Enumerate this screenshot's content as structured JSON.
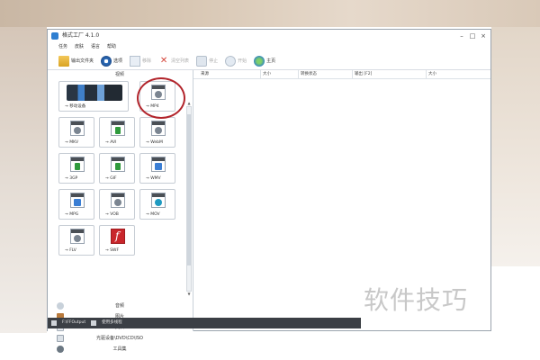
{
  "window": {
    "title": "格式工厂 4.1.0",
    "controls": [
      "–",
      "□",
      "×"
    ]
  },
  "menubar": [
    "任务",
    "皮肤",
    "语言",
    "帮助"
  ],
  "toolbar": {
    "output_folder": "输出文件夹",
    "options": "选项",
    "remove": "移除",
    "clear_list": "清空列表",
    "stop": "停止",
    "start": "开始",
    "home": "主页"
  },
  "left_panel": {
    "header": "视频",
    "tiles": [
      {
        "label": "→ 移动设备",
        "icon": "mobile-devices-icon"
      },
      {
        "label": "→ MP4",
        "icon": "mp4-file-icon"
      },
      {
        "label": "→ MKV",
        "icon": "mkv-file-icon"
      },
      {
        "label": "→ AVI",
        "icon": "avi-file-icon"
      },
      {
        "label": "→ WebM",
        "icon": "webm-file-icon"
      },
      {
        "label": "→ 3GP",
        "icon": "3gp-file-icon"
      },
      {
        "label": "→ GIF",
        "icon": "gif-file-icon"
      },
      {
        "label": "→ WMV",
        "icon": "wmv-file-icon"
      },
      {
        "label": "→ MPG",
        "icon": "mpg-file-icon"
      },
      {
        "label": "→ VOB",
        "icon": "vob-file-icon"
      },
      {
        "label": "→ MOV",
        "icon": "mov-file-icon"
      },
      {
        "label": "→ FLV",
        "icon": "flv-file-icon"
      },
      {
        "label": "→ SWF",
        "icon": "swf-file-icon"
      }
    ],
    "categories": [
      "音频",
      "图片",
      "文档",
      "光驱设备\\DVD\\CD\\ISO",
      "工具集"
    ]
  },
  "file_list": {
    "columns": [
      "来源",
      "大小",
      "转换状态",
      "输出 [F2]",
      "大小"
    ]
  },
  "statusbar": {
    "output_path": "F:\\FFOutput",
    "notify": "使用多线程"
  },
  "watermark": "软件技巧",
  "colors": {
    "annotation": "#b2242b",
    "statusbar": "#3b3f45"
  }
}
